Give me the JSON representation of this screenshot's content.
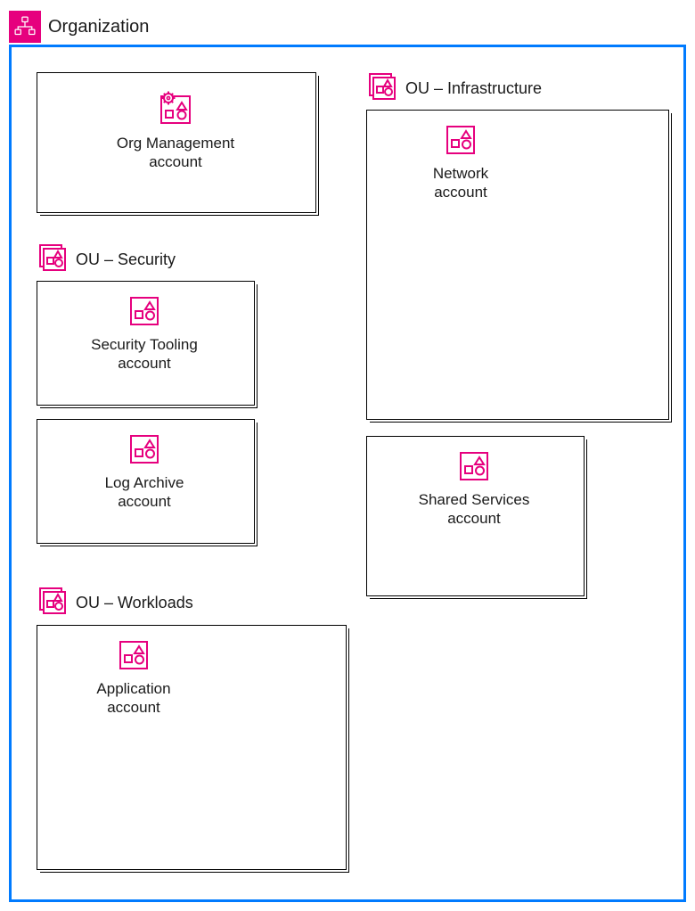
{
  "colors": {
    "brand": "#e6007e",
    "frame": "#007bff"
  },
  "org": {
    "title": "Organization"
  },
  "accounts": {
    "org_management": "Org Management\naccount",
    "security_tooling": "Security Tooling\naccount",
    "log_archive": "Log Archive\naccount",
    "network": "Network\naccount",
    "shared_services": "Shared Services\naccount",
    "application": "Application\naccount"
  },
  "ous": {
    "security": "OU – Security",
    "infrastructure": "OU – Infrastructure",
    "workloads": "OU – Workloads"
  }
}
